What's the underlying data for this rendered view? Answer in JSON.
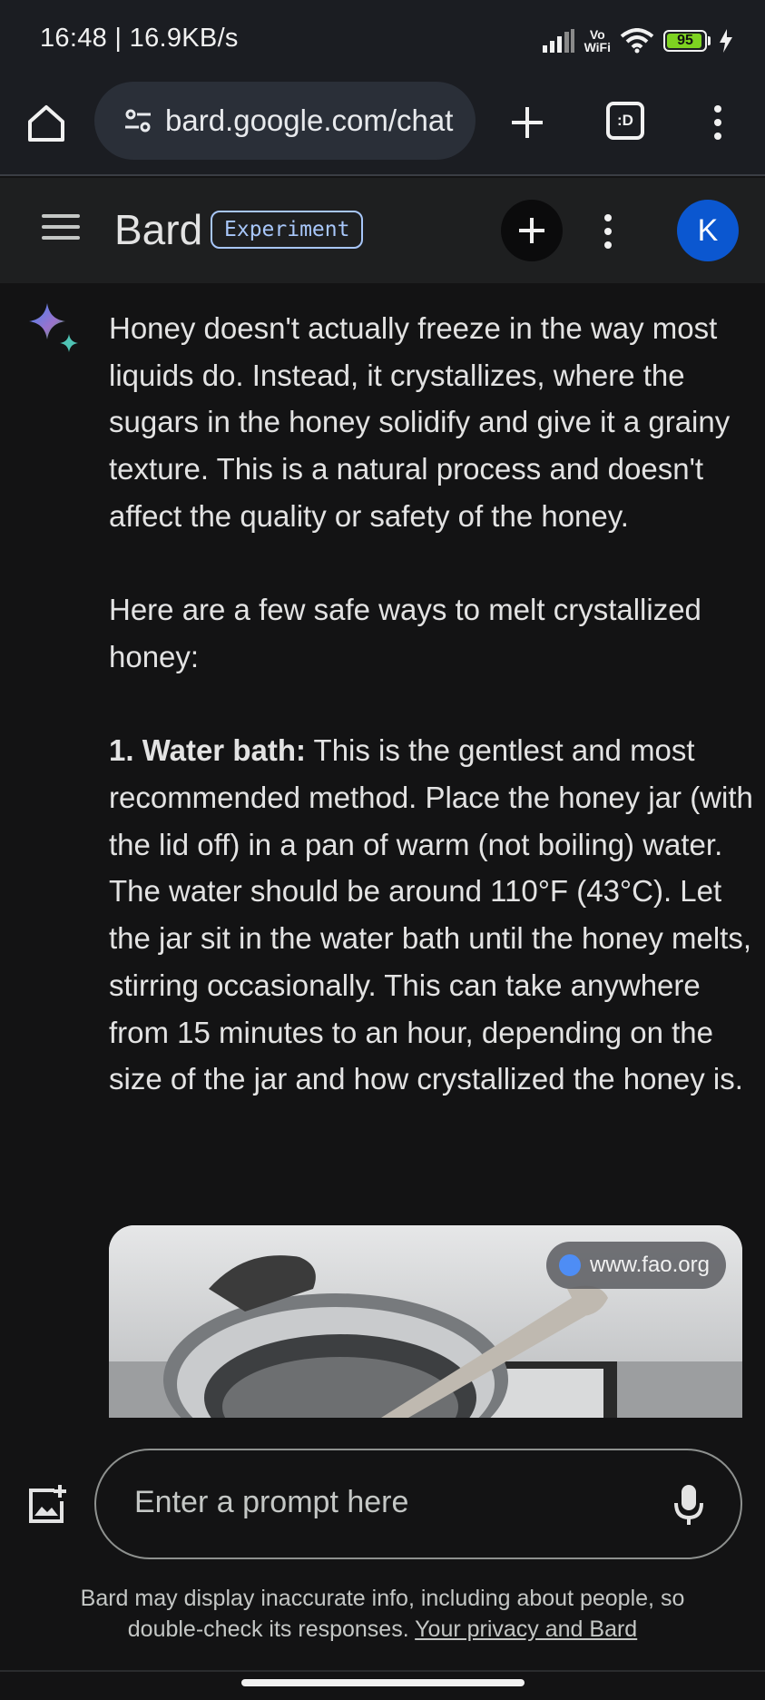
{
  "status_bar": {
    "time": "16:48",
    "network_speed": "16.9KB/s",
    "vowifi_top": "Vo",
    "vowifi_bottom": "WiFi",
    "battery": "95"
  },
  "browser": {
    "url": "bard.google.com/chat",
    "tabs_label": ":D"
  },
  "app_header": {
    "brand": "Bard",
    "badge": "Experiment",
    "avatar_initial": "K"
  },
  "response": {
    "paragraph_1": "Honey doesn't actually freeze in the way most liquids do. Instead, it crystallizes, where the sugars in the honey solidify and give it a grainy texture. This is a natural process and doesn't affect the quality or safety of the honey.",
    "paragraph_2": "Here are a few safe ways to melt crystallized honey:",
    "step_1_title": "1. Water bath:",
    "step_1_text": " This is the gentlest and most recommended method. Place the honey jar (with the lid off) in a pan of warm (not boiling) water. The water should be around 110°F (43°C). Let the jar sit in the water bath until the honey melts, stirring occasionally. This can take anywhere from 15 minutes to an hour, depending on the size of the jar and how crystallized the honey is.",
    "image_source": "www.fao.org"
  },
  "prompt": {
    "placeholder": "Enter a prompt here",
    "disclaimer": "Bard may display inaccurate info, including about people, so double-check its responses.",
    "privacy_link": "Your privacy and Bard"
  },
  "icons": {
    "home": "home-icon",
    "site_settings": "tune-icon",
    "new_tab": "plus-icon",
    "menu": "more-vert-icon",
    "spark": "bard-sparkle-icon",
    "add_image": "add-photo-icon",
    "mic": "mic-icon",
    "globe": "globe-icon"
  },
  "colors": {
    "background": "#131314",
    "header": "#1e1f20",
    "accent_badge": "#a8c7fa",
    "avatar": "#0b57d0",
    "battery_fill": "#7ed321"
  }
}
